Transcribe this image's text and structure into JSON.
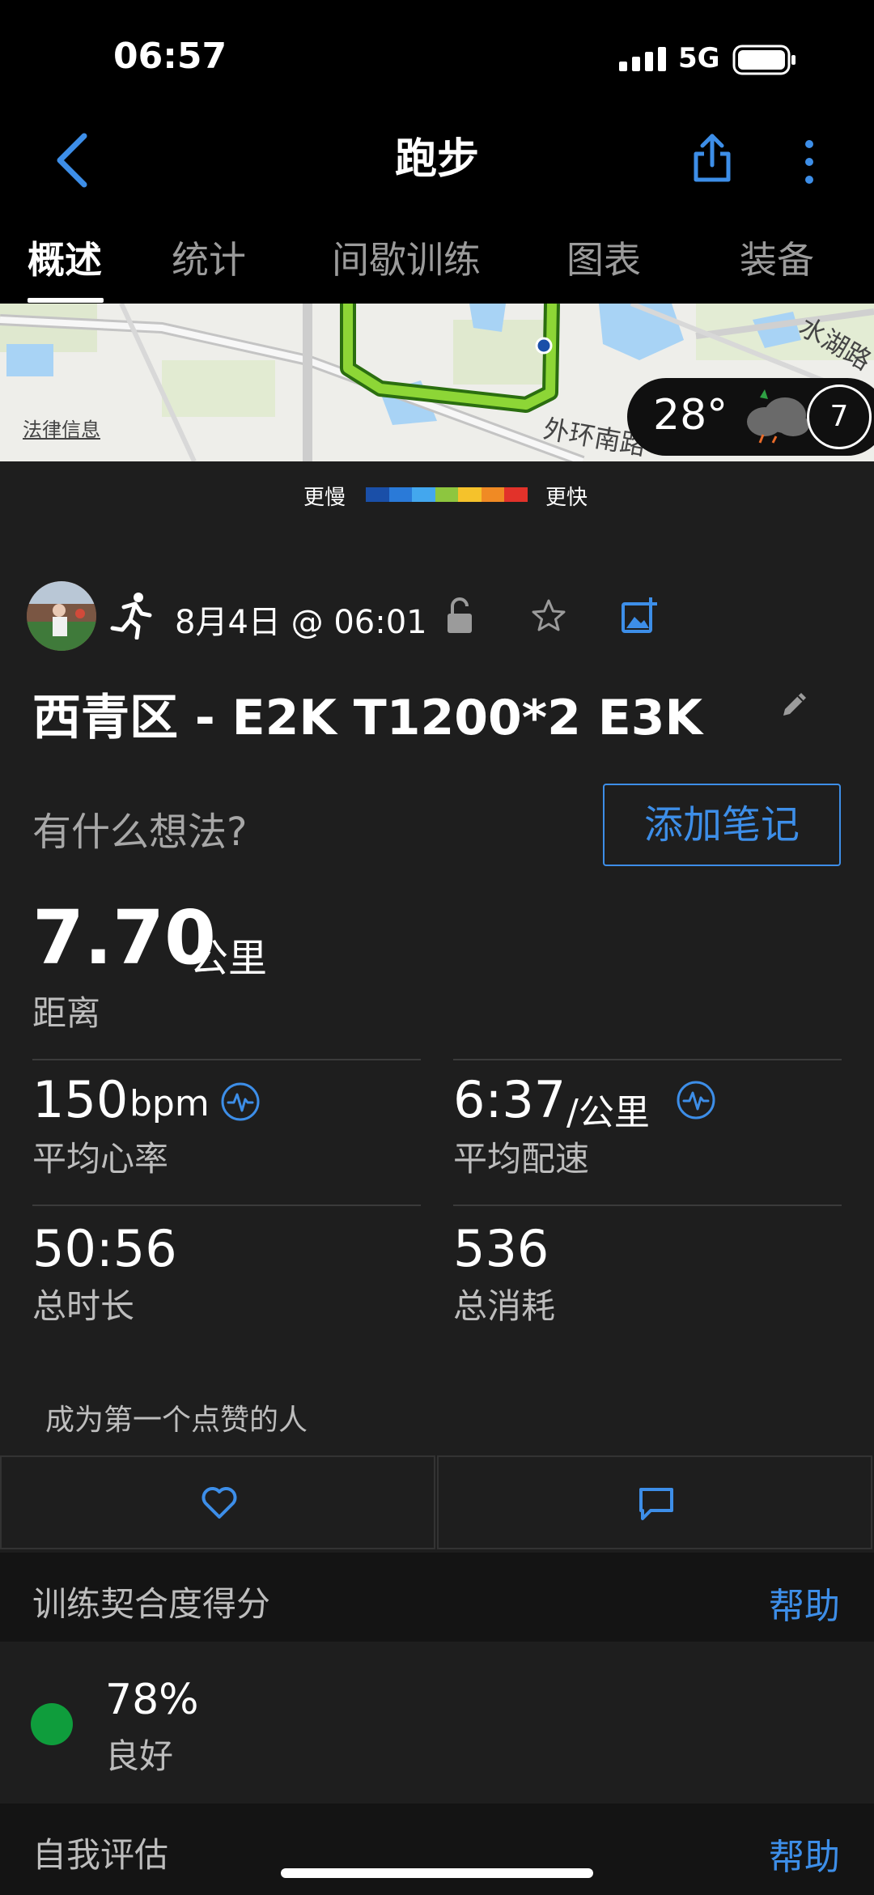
{
  "status_bar": {
    "time": "06:57",
    "network": "5G"
  },
  "nav": {
    "title": "跑步"
  },
  "tabs": [
    {
      "label": "概述",
      "active": true
    },
    {
      "label": "统计",
      "active": false
    },
    {
      "label": "间歇训练",
      "active": false
    },
    {
      "label": "图表",
      "active": false
    },
    {
      "label": "装备",
      "active": false
    }
  ],
  "map": {
    "legal_label": "法律信息",
    "road_label_1": "外环南路",
    "road_label_2": "水湖路",
    "weather_temp": "28°",
    "wind_value": "7"
  },
  "pace_legend": {
    "slow_label": "更慢",
    "fast_label": "更快",
    "colors": [
      "#1a4fa8",
      "#2a7ad8",
      "#43a7ee",
      "#8dc63f",
      "#f5c22b",
      "#f08a24",
      "#e2322a"
    ]
  },
  "activity": {
    "date_time": "8月4日 @ 06:01",
    "title": "西青区 - E2K T1200*2 E3K",
    "thought_placeholder": "有什么想法?",
    "add_note_label": "添加笔记"
  },
  "distance": {
    "value": "7.70",
    "unit": "公里",
    "label": "距离"
  },
  "stats": {
    "heart_rate": {
      "value": "150",
      "unit": "bpm",
      "label": "平均心率"
    },
    "pace": {
      "value": "6:37",
      "unit": "/公里",
      "label": "平均配速"
    },
    "duration": {
      "value": "50:56",
      "label": "总时长"
    },
    "calories": {
      "value": "536",
      "label": "总消耗"
    }
  },
  "social": {
    "like_prompt": "成为第一个点赞的人"
  },
  "training_score": {
    "section_title": "训练契合度得分",
    "help_label": "帮助",
    "value": "78%",
    "label": "良好",
    "status_color": "#0f9d3c"
  },
  "self_eval": {
    "section_title": "自我评估",
    "help_label": "帮助"
  },
  "colors": {
    "accent": "#3d8ee8",
    "background": "#1e1e1e"
  }
}
